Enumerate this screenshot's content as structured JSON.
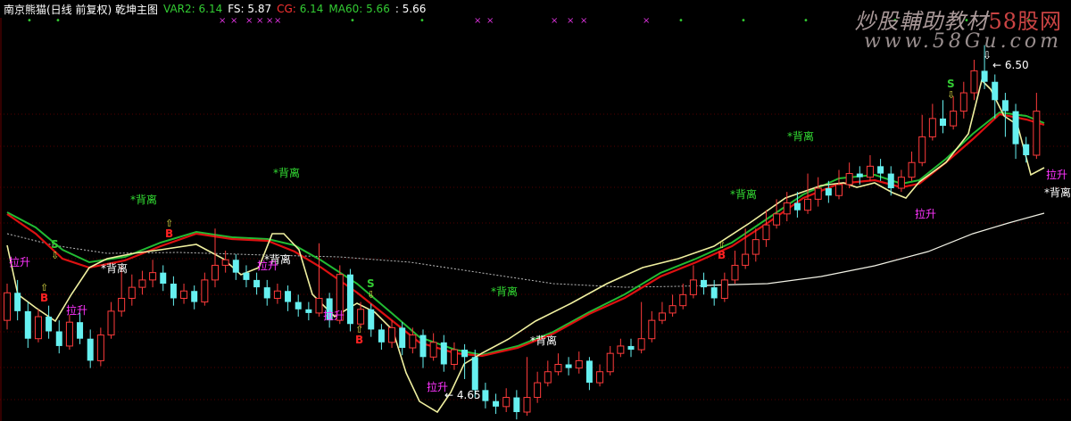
{
  "header": {
    "title": "南京熊猫(日线 前复权) 乾坤主图",
    "indicators": [
      {
        "label": "VAR2:",
        "value": "6.14",
        "color": "#33cc33"
      },
      {
        "label": "FS:",
        "value": "5.87",
        "color": "#ffffff"
      },
      {
        "label": "CG:",
        "value": "6.14",
        "color": "#ff3333",
        "value_color": "#33cc33"
      },
      {
        "label": "MA60:",
        "value": "5.66",
        "color": "#33cc33"
      },
      {
        "label": "",
        "value": "5.66",
        "color": "#ffffff"
      }
    ]
  },
  "watermark": {
    "line1_prefix": "炒股輔助教材",
    "line1_highlight": "58股网",
    "line2": "www.58Gu.com"
  },
  "colors": {
    "up": "#ff3b3b",
    "down": "#66f0f0",
    "ma_red": "#dd1111",
    "ma_green": "#22bb33",
    "yellow_line": "#f0f0a0",
    "white_line": "#f2f2e6",
    "grid": "#550000",
    "label_green": "#33dd33",
    "label_white": "#ffffff",
    "label_magenta": "#ff33ff",
    "marker_green": "#33cc33",
    "marker_red": "#ff2222",
    "marker_magenta": "#dd33dd"
  },
  "annotations": {
    "high_price": "6.50",
    "low_price": "4.65",
    "labels": [
      {
        "text": "*背离",
        "color": "green"
      },
      {
        "text": "*背离",
        "color": "green"
      },
      {
        "text": "*背离",
        "color": "green"
      },
      {
        "text": "*背离",
        "color": "green"
      },
      {
        "text": "*背离",
        "color": "green"
      },
      {
        "text": "*背离",
        "color": "white"
      },
      {
        "text": "*背离",
        "color": "white"
      },
      {
        "text": "*背离",
        "color": "white"
      },
      {
        "text": "*背离",
        "color": "white"
      },
      {
        "text": "拉升",
        "color": "magenta"
      },
      {
        "text": "拉升",
        "color": "magenta"
      },
      {
        "text": "拉升",
        "color": "magenta"
      },
      {
        "text": "拉升",
        "color": "magenta"
      },
      {
        "text": "拉升",
        "color": "magenta"
      },
      {
        "text": "拉升",
        "color": "magenta"
      },
      {
        "text": "拉升",
        "color": "magenta"
      }
    ],
    "markers": [
      "S",
      "S",
      "S",
      "B",
      "B",
      "B",
      "B"
    ]
  },
  "chart_data": {
    "type": "candlestick",
    "ylim": [
      4.5,
      6.6
    ],
    "grid": true,
    "candles": [
      [
        5.0,
        5.15,
        5.2,
        4.95
      ],
      [
        5.15,
        5.05,
        5.22,
        5.0
      ],
      [
        5.05,
        4.9,
        5.1,
        4.85
      ],
      [
        4.9,
        5.02,
        5.06,
        4.88
      ],
      [
        5.02,
        4.94,
        5.08,
        4.9
      ],
      [
        4.94,
        4.86,
        5.0,
        4.82
      ],
      [
        4.86,
        4.99,
        5.03,
        4.84
      ],
      [
        4.99,
        4.9,
        5.04,
        4.87
      ],
      [
        4.9,
        4.78,
        4.95,
        4.74
      ],
      [
        4.78,
        4.92,
        4.96,
        4.75
      ],
      [
        4.92,
        5.05,
        5.1,
        4.9
      ],
      [
        5.05,
        5.12,
        5.3,
        5.02
      ],
      [
        5.12,
        5.18,
        5.25,
        5.08
      ],
      [
        5.18,
        5.22,
        5.27,
        5.14
      ],
      [
        5.22,
        5.26,
        5.33,
        5.18
      ],
      [
        5.26,
        5.2,
        5.3,
        5.16
      ],
      [
        5.2,
        5.12,
        5.24,
        5.08
      ],
      [
        5.12,
        5.16,
        5.2,
        5.09
      ],
      [
        5.16,
        5.1,
        5.19,
        5.06
      ],
      [
        5.1,
        5.22,
        5.26,
        5.08
      ],
      [
        5.22,
        5.3,
        5.5,
        5.18
      ],
      [
        5.3,
        5.33,
        5.38,
        5.26
      ],
      [
        5.33,
        5.26,
        5.36,
        5.22
      ],
      [
        5.26,
        5.22,
        5.3,
        5.18
      ],
      [
        5.22,
        5.18,
        5.26,
        5.14
      ],
      [
        5.18,
        5.12,
        5.22,
        5.08
      ],
      [
        5.12,
        5.16,
        5.2,
        5.09
      ],
      [
        5.16,
        5.1,
        5.19,
        5.05
      ],
      [
        5.1,
        5.06,
        5.14,
        5.02
      ],
      [
        5.06,
        5.04,
        5.1,
        5.0
      ],
      [
        5.04,
        5.12,
        5.42,
        5.02
      ],
      [
        5.12,
        5.0,
        5.15,
        4.96
      ],
      [
        5.0,
        5.25,
        5.3,
        4.98
      ],
      [
        5.25,
        4.98,
        5.28,
        4.94
      ],
      [
        4.98,
        5.06,
        5.1,
        4.96
      ],
      [
        5.06,
        4.95,
        5.09,
        4.91
      ],
      [
        4.95,
        4.88,
        4.98,
        4.84
      ],
      [
        4.88,
        4.96,
        5.0,
        4.85
      ],
      [
        4.96,
        4.85,
        4.99,
        4.81
      ],
      [
        4.85,
        4.92,
        4.96,
        4.82
      ],
      [
        4.92,
        4.8,
        4.95,
        4.74
      ],
      [
        4.8,
        4.88,
        4.93,
        4.78
      ],
      [
        4.88,
        4.76,
        4.92,
        4.72
      ],
      [
        4.76,
        4.84,
        4.88,
        4.73
      ],
      [
        4.84,
        4.8,
        4.87,
        4.68
      ],
      [
        4.8,
        4.62,
        4.84,
        4.58
      ],
      [
        4.62,
        4.56,
        4.66,
        4.52
      ],
      [
        4.56,
        4.53,
        4.6,
        4.49
      ],
      [
        4.53,
        4.58,
        4.63,
        4.5
      ],
      [
        4.58,
        4.5,
        4.62,
        4.46
      ],
      [
        4.5,
        4.58,
        4.8,
        4.48
      ],
      [
        4.58,
        4.66,
        4.72,
        4.55
      ],
      [
        4.66,
        4.72,
        4.78,
        4.64
      ],
      [
        4.72,
        4.76,
        4.82,
        4.7
      ],
      [
        4.76,
        4.74,
        4.8,
        4.7
      ],
      [
        4.74,
        4.78,
        4.83,
        4.71
      ],
      [
        4.78,
        4.66,
        4.8,
        4.62
      ],
      [
        4.66,
        4.72,
        4.76,
        4.64
      ],
      [
        4.72,
        4.82,
        4.86,
        4.7
      ],
      [
        4.82,
        4.86,
        4.9,
        4.8
      ],
      [
        4.86,
        4.84,
        4.9,
        4.8
      ],
      [
        4.84,
        4.9,
        5.1,
        4.82
      ],
      [
        4.9,
        5.0,
        5.05,
        4.88
      ],
      [
        5.0,
        5.04,
        5.1,
        4.98
      ],
      [
        5.04,
        5.08,
        5.14,
        5.02
      ],
      [
        5.08,
        5.14,
        5.2,
        5.06
      ],
      [
        5.14,
        5.22,
        5.3,
        5.12
      ],
      [
        5.22,
        5.18,
        5.26,
        5.14
      ],
      [
        5.18,
        5.12,
        5.22,
        5.08
      ],
      [
        5.12,
        5.22,
        5.26,
        5.1
      ],
      [
        5.22,
        5.3,
        5.38,
        5.2
      ],
      [
        5.3,
        5.36,
        5.5,
        5.28
      ],
      [
        5.36,
        5.44,
        5.5,
        5.32
      ],
      [
        5.44,
        5.52,
        5.6,
        5.4
      ],
      [
        5.52,
        5.58,
        5.66,
        5.5
      ],
      [
        5.58,
        5.64,
        5.7,
        5.54
      ],
      [
        5.64,
        5.6,
        5.7,
        5.56
      ],
      [
        5.6,
        5.66,
        5.8,
        5.58
      ],
      [
        5.66,
        5.72,
        5.78,
        5.62
      ],
      [
        5.72,
        5.68,
        5.76,
        5.64
      ],
      [
        5.68,
        5.74,
        5.82,
        5.66
      ],
      [
        5.74,
        5.8,
        5.86,
        5.72
      ],
      [
        5.8,
        5.78,
        5.84,
        5.74
      ],
      [
        5.78,
        5.84,
        5.9,
        5.76
      ],
      [
        5.84,
        5.8,
        5.88,
        5.76
      ],
      [
        5.8,
        5.72,
        5.84,
        5.68
      ],
      [
        5.72,
        5.78,
        5.82,
        5.7
      ],
      [
        5.78,
        5.86,
        5.92,
        5.76
      ],
      [
        5.86,
        6.0,
        6.12,
        5.84
      ],
      [
        6.0,
        6.1,
        6.18,
        5.98
      ],
      [
        6.1,
        6.06,
        6.2,
        6.02
      ],
      [
        6.06,
        6.14,
        6.22,
        6.04
      ],
      [
        6.14,
        6.24,
        6.3,
        6.1
      ],
      [
        6.24,
        6.36,
        6.42,
        6.2
      ],
      [
        6.36,
        6.3,
        6.5,
        6.26
      ],
      [
        6.3,
        6.2,
        6.34,
        6.1
      ],
      [
        6.2,
        6.14,
        6.24,
        6.0
      ],
      [
        6.14,
        5.96,
        6.18,
        5.88
      ],
      [
        5.96,
        5.9,
        6.0,
        5.86
      ],
      [
        5.9,
        6.14,
        6.24,
        5.88
      ]
    ]
  }
}
